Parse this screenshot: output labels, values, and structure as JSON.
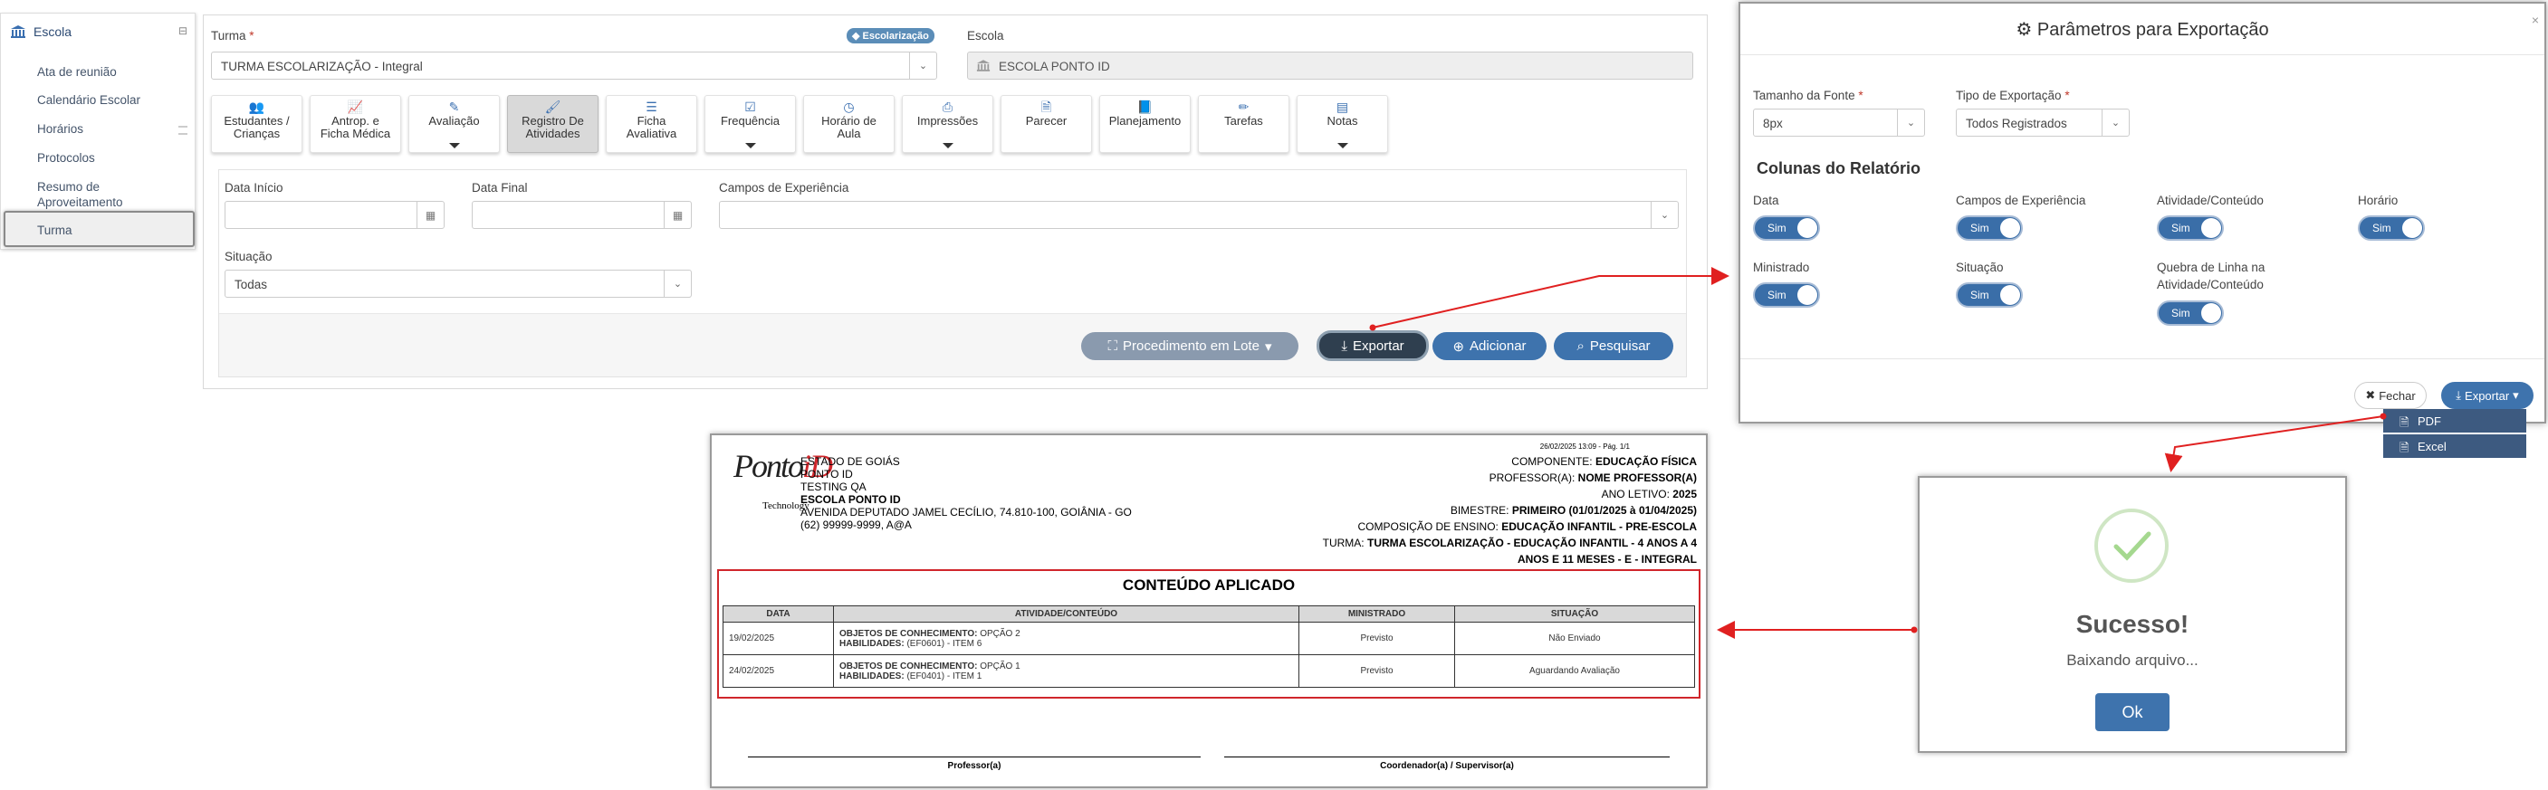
{
  "sidebar": {
    "header": "Escola",
    "items": [
      "Ata de reunião",
      "Calendário Escolar",
      "Horários",
      "Protocolos",
      "Resumo de",
      "Aproveitamento",
      "Turma"
    ]
  },
  "main": {
    "turma_label": "Turma",
    "turma_value": "TURMA ESCOLARIZAÇÃO - Integral",
    "badge": "Escolarização",
    "escola_label": "Escola",
    "escola_value": "ESCOLA PONTO ID",
    "tiles": [
      {
        "l1": "Estudantes /",
        "l2": "Crianças",
        "icon": "users-icon"
      },
      {
        "l1": "Antrop. e",
        "l2": "Ficha Médica",
        "icon": "chart-icon"
      },
      {
        "l1": "Avaliação",
        "l2": "",
        "icon": "edit-icon"
      },
      {
        "l1": "Registro De",
        "l2": "Atividades",
        "icon": "brush-icon"
      },
      {
        "l1": "Ficha",
        "l2": "Avaliativa",
        "icon": "list-icon"
      },
      {
        "l1": "Frequência",
        "l2": "",
        "icon": "check-icon"
      },
      {
        "l1": "Horário de",
        "l2": "Aula",
        "icon": "clock-icon"
      },
      {
        "l1": "Impressões",
        "l2": "",
        "icon": "print-icon"
      },
      {
        "l1": "Parecer",
        "l2": "",
        "icon": "file-icon"
      },
      {
        "l1": "Planejamento",
        "l2": "",
        "icon": "book-icon"
      },
      {
        "l1": "Tarefas",
        "l2": "",
        "icon": "pen-icon"
      },
      {
        "l1": "Notas",
        "l2": "",
        "icon": "notes-icon"
      }
    ],
    "filters": {
      "data_inicio": "Data Início",
      "data_final": "Data Final",
      "campos": "Campos de Experiência",
      "situacao": "Situação",
      "situacao_value": "Todas"
    },
    "buttons": {
      "lote": "Procedimento em Lote",
      "exportar": "Exportar",
      "adicionar": "Adicionar",
      "pesquisar": "Pesquisar"
    }
  },
  "modal": {
    "title": "Parâmetros para Exportação",
    "fonte_label": "Tamanho da Fonte",
    "fonte_value": "8px",
    "tipo_label": "Tipo de Exportação",
    "tipo_value": "Todos Registrados",
    "colunas_title": "Colunas do Relatório",
    "toggles": [
      {
        "label": "Data",
        "state": "Sim"
      },
      {
        "label": "Campos de Experiência",
        "state": "Sim"
      },
      {
        "label": "Atividade/Conteúdo",
        "state": "Sim"
      },
      {
        "label": "Horário",
        "state": "Sim"
      },
      {
        "label": "Ministrado",
        "state": "Sim"
      },
      {
        "label": "Situação",
        "state": "Sim"
      },
      {
        "label": "Quebra de Linha na",
        "label2": "Atividade/Conteúdo",
        "state": "Sim"
      }
    ],
    "fechar": "Fechar",
    "exportar": "Exportar",
    "dropdown": [
      "PDF",
      "Excel"
    ]
  },
  "report": {
    "timestamp": "26/02/2025 13:09 - Pág. 1/1",
    "logo_text": "PontoID",
    "logo_sub": "Technology",
    "left_lines": [
      "ESTADO DE GOIÁS",
      "PONTO ID",
      "TESTING QA",
      "ESCOLA PONTO ID",
      "AVENIDA DEPUTADO JAMEL CECÍLIO, 74.810-100, GOIÂNIA - GO",
      "(62) 99999-9999, A@A"
    ],
    "right": [
      {
        "k": "COMPONENTE:",
        "v": "EDUCAÇÃO FÍSICA"
      },
      {
        "k": "PROFESSOR(A):",
        "v": "NOME PROFESSOR(A)"
      },
      {
        "k": "ANO LETIVO:",
        "v": "2025"
      },
      {
        "k": "BIMESTRE:",
        "v": "PRIMEIRO (01/01/2025 à 01/04/2025)"
      },
      {
        "k": "COMPOSIÇÃO DE ENSINO:",
        "v": "EDUCAÇÃO INFANTIL - PRE-ESCOLA"
      },
      {
        "k": "TURMA:",
        "v": "TURMA ESCOLARIZAÇÃO - EDUCAÇÃO INFANTIL - 4 ANOS A 4"
      },
      {
        "k": "",
        "v": "ANOS E 11 MESES - E - INTEGRAL"
      }
    ],
    "section_title": "CONTEÚDO APLICADO",
    "headers": [
      "DATA",
      "ATIVIDADE/CONTEÚDO",
      "MINISTRADO",
      "SITUAÇÃO"
    ],
    "rows": [
      {
        "data": "19/02/2025",
        "obj_k": "OBJETOS DE CONHECIMENTO:",
        "obj_v": "OPÇÃO 2",
        "hab_k": "HABILIDADES:",
        "hab_v": "(EF0601) - ITEM 6",
        "ministrado": "Previsto",
        "situacao": "Não Enviado"
      },
      {
        "data": "24/02/2025",
        "obj_k": "OBJETOS DE CONHECIMENTO:",
        "obj_v": "OPÇÃO 1",
        "hab_k": "HABILIDADES:",
        "hab_v": "(EF0401) - ITEM 1",
        "ministrado": "Previsto",
        "situacao": "Aguardando Avaliação"
      }
    ],
    "sign_left": "Professor(a)",
    "sign_right": "Coordenador(a) / Supervisor(a)"
  },
  "success": {
    "title": "Sucesso!",
    "message": "Baixando arquivo...",
    "ok": "Ok"
  },
  "colors": {
    "primary": "#3e73ad",
    "dark": "#2f3f4f",
    "muted": "#8a9aae",
    "arrow": "#e02020"
  }
}
